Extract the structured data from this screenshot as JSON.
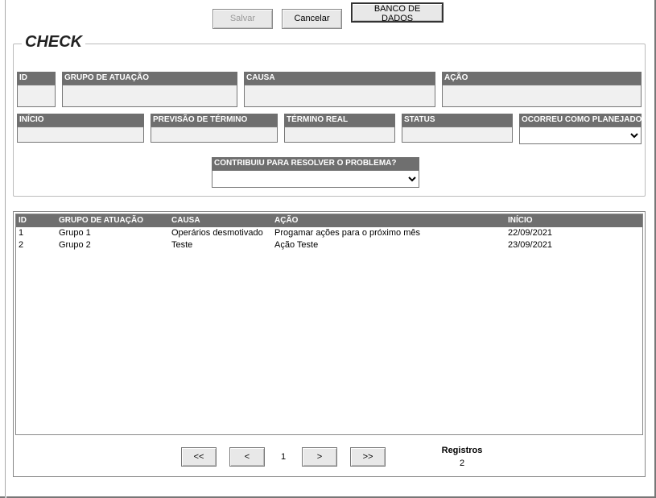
{
  "toolbar": {
    "save_label": "Salvar",
    "cancel_label": "Cancelar",
    "db_label": "BANCO DE DADOS"
  },
  "group": {
    "title": "CHECK",
    "labels": {
      "id": "ID",
      "grupo": "GRUPO DE ATUAÇÃO",
      "causa": "CAUSA",
      "acao": "AÇÃO",
      "inicio": "INÍCIO",
      "previsao": "PREVISÃO DE TÉRMINO",
      "termino": "TÉRMINO REAL",
      "status": "STATUS",
      "ocorreu": "OCORREU COMO PLANEJADO?",
      "contribuiu": "CONTRIBUIU PARA RESOLVER O PROBLEMA?"
    },
    "values": {
      "id": "",
      "grupo": "",
      "causa": "",
      "acao": "",
      "inicio": "",
      "previsao": "",
      "termino": "",
      "status": "",
      "ocorreu": "",
      "contribuiu": ""
    }
  },
  "list": {
    "headers": {
      "id": "ID",
      "grupo": "GRUPO DE ATUAÇÃO",
      "causa": "CAUSA",
      "acao": "AÇÃO",
      "inicio": "INÍCIO"
    },
    "rows": [
      {
        "id": "1",
        "grupo": "Grupo 1",
        "causa": "Operários desmotivado",
        "acao": "Progamar ações para o próximo mês",
        "inicio": "22/09/2021"
      },
      {
        "id": "2",
        "grupo": "Grupo 2",
        "causa": "Teste",
        "acao": "Ação Teste",
        "inicio": "23/09/2021"
      }
    ]
  },
  "pager": {
    "first": "<<",
    "prev": "<",
    "next": ">",
    "last": ">>",
    "page": "1",
    "records_label": "Registros",
    "records_count": "2"
  }
}
